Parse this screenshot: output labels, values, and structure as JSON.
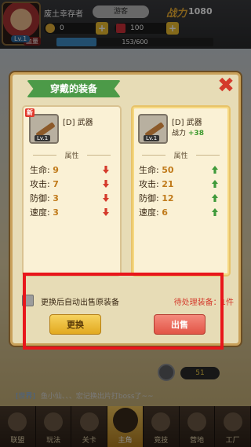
{
  "header": {
    "player_name": "废土幸存者",
    "avatar_level": "Lv.1",
    "vip_label": "游客",
    "power_label": "战力",
    "power_value": "1080",
    "coins": "0",
    "gems": "100",
    "hp_tag": "血量",
    "exp_text": "153/600",
    "exp_fraction": 0.255
  },
  "dialog": {
    "title": "穿戴的装备",
    "close_glyph": "✖",
    "equipped": {
      "new_tag": "新",
      "icon_level": "Lv.1",
      "name": "[D] 武器",
      "attr_title": "属性",
      "attrs": [
        {
          "label": "生命:",
          "value": "9",
          "trend": "down"
        },
        {
          "label": "攻击:",
          "value": "7",
          "trend": "down"
        },
        {
          "label": "防御:",
          "value": "3",
          "trend": "down"
        },
        {
          "label": "速度:",
          "value": "3",
          "trend": "down"
        }
      ]
    },
    "candidate": {
      "icon_level": "Lv.1",
      "name": "[D] 武器",
      "power_label": "战力",
      "power_delta": "+38",
      "attr_title": "属性",
      "attrs": [
        {
          "label": "生命:",
          "value": "50",
          "trend": "up"
        },
        {
          "label": "攻击:",
          "value": "21",
          "trend": "up"
        },
        {
          "label": "防御:",
          "value": "12",
          "trend": "up"
        },
        {
          "label": "速度:",
          "value": "6",
          "trend": "up"
        }
      ]
    },
    "auto_sell_label": "更换后自动出售原装备",
    "pending_label": "待处理装备：1件",
    "replace_button": "更换",
    "sell_button": "出售"
  },
  "chat": {
    "channel": "[世界]",
    "message": "鱼小仙、、、宏记换出片打boss了~~"
  },
  "score_badge": "51",
  "nav": [
    {
      "label": "联盟",
      "active": false
    },
    {
      "label": "玩法",
      "active": false
    },
    {
      "label": "关卡",
      "active": false
    },
    {
      "label": "主角",
      "active": true
    },
    {
      "label": "竞技",
      "active": false
    },
    {
      "label": "营地",
      "active": false
    },
    {
      "label": "工厂",
      "active": false
    }
  ],
  "colors": {
    "highlight": "#e8161b",
    "ribbon": "#4c9a48",
    "stat_up": "#3f9a3a",
    "stat_down": "#d43a2b"
  }
}
